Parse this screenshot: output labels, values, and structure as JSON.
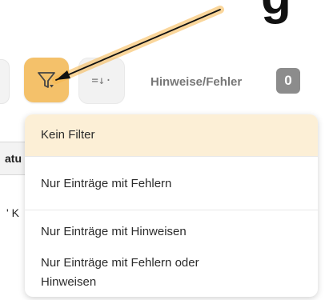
{
  "header": {
    "top_glyph": "g"
  },
  "toolbar": {
    "filter_icon": "filter-icon",
    "sort_icon": "sort-icon",
    "sort_glyph": "=↓·",
    "notices_label": "Hinweise/Fehler",
    "notices_count": "0"
  },
  "background_table": {
    "header_fragment": "atu",
    "row_fragment": "' K"
  },
  "filter_menu": {
    "items": [
      {
        "label": "Kein Filter",
        "selected": true
      },
      {
        "label": "Nur Einträge mit Fehlern",
        "selected": false
      },
      {
        "label": "Nur Einträge mit Hinweisen",
        "selected": false
      },
      {
        "label": "Nur Einträge mit Fehlern oder Hinweisen",
        "selected": false
      }
    ],
    "item_4_line1": "Nur Einträge mit Fehlern oder",
    "item_4_line2": "Hinweisen"
  },
  "colors": {
    "accent": "#f4c16a",
    "selected_bg": "#fcefd6",
    "badge_bg": "#8c8c8c",
    "arrow_glow": "#f7b64a"
  }
}
